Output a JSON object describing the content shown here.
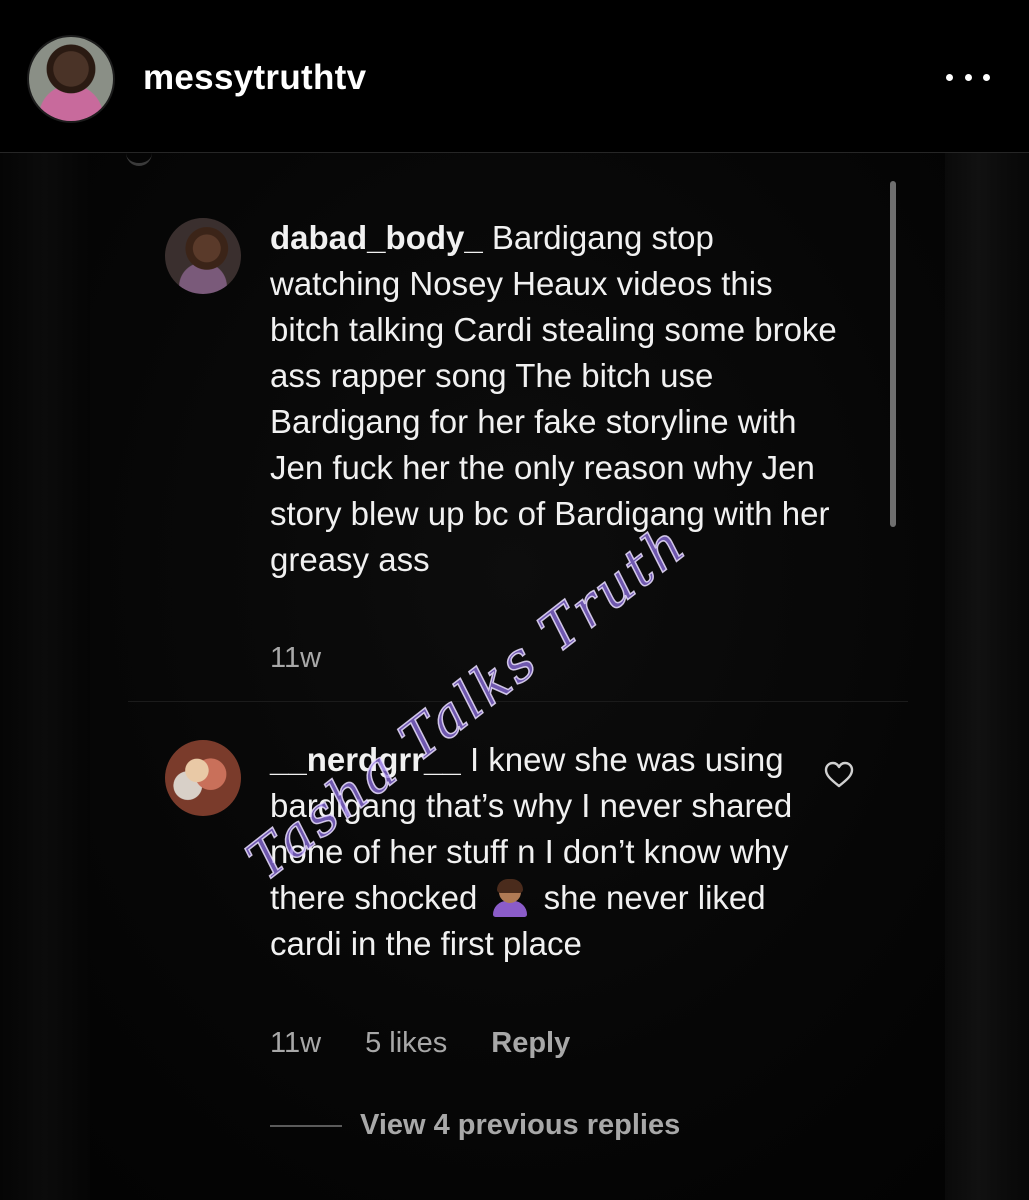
{
  "post_header": {
    "username": "messytruthtv",
    "more_icon": "more-horizontal-icon"
  },
  "comments": [
    {
      "username": "dabad_body_",
      "text": "Bardigang stop watching Nosey Heaux videos this bitch talking Cardi stealing some broke ass rapper song The bitch use Bardigang for her fake storyline with Jen fuck her the only reason why Jen story blew up bc of Bardigang with her greasy ass",
      "time": "11w"
    },
    {
      "username": "__nerdgrr__",
      "text_before_emoji": "I knew she was using bardigang that’s why I never shared none of her stuff n I don’t know why there shocked",
      "emoji": "woman-facepalming-emoji",
      "text_after_emoji": "she never liked cardi in the first place",
      "time": "11w",
      "likes": "5 likes",
      "reply_label": "Reply"
    }
  ],
  "view_replies": {
    "label": "View 4 previous replies"
  },
  "watermark": {
    "text": "Tasha Talks Truth"
  },
  "colors": {
    "background": "#000000",
    "text": "#f1f1f1",
    "meta_text": "#a8a8a8",
    "watermark": "#8c6edc"
  }
}
